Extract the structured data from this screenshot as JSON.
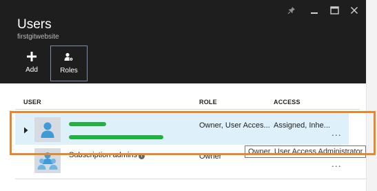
{
  "blade": {
    "title": "Users",
    "subtitle": "firstgitwebsite"
  },
  "commands": [
    {
      "label": "Add",
      "icon": "plus-icon"
    },
    {
      "label": "Roles",
      "icon": "roles-icon"
    }
  ],
  "table": {
    "columns": [
      "USER",
      "ROLE",
      "ACCESS"
    ],
    "rows": [
      {
        "user": "",
        "email": "",
        "role": "Owner, User Acces...",
        "access": "Assigned, Inhe...",
        "more": "..."
      },
      {
        "user": "Subscription admins",
        "email": "",
        "role": "Owner",
        "access": "",
        "more": "..."
      }
    ]
  },
  "tooltip": "Owner, User Access Administrator",
  "colors": {
    "header_bg": "#1e1e1e",
    "selected_row": "#def0fa",
    "highlight": "#e8862a",
    "redaction": "#22b043"
  }
}
